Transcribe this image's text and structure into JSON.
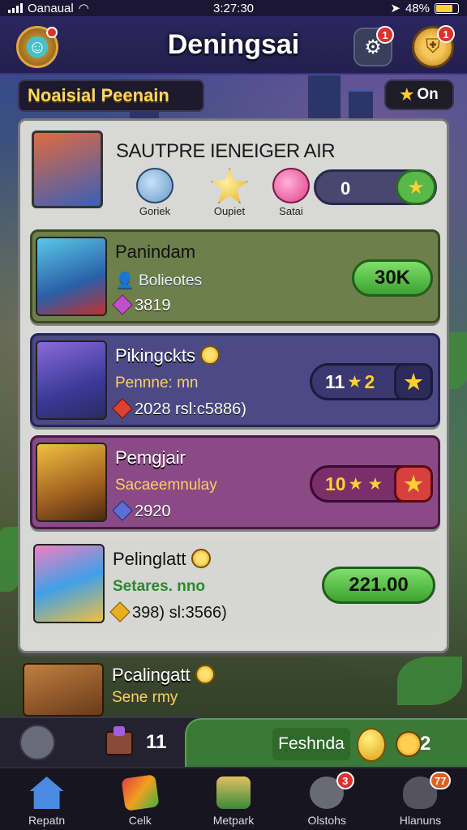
{
  "status_bar": {
    "carrier": "Oanaual",
    "time": "3:27:30",
    "battery": "48%"
  },
  "header": {
    "title": "Deningsai",
    "avatar_badge": "",
    "gear_badge": "1",
    "shield_badge": "1"
  },
  "section": {
    "label": "Noaisial Peenain",
    "toggle_label": "On"
  },
  "featured": {
    "title": "SAUTPRE IENEIGER AIR",
    "pets": [
      {
        "label": "Goriek",
        "icon": "ghost-pet-icon"
      },
      {
        "label": "Oupiet",
        "icon": "star-pet-icon"
      },
      {
        "label": "Satai",
        "icon": "pink-pet-icon"
      }
    ],
    "count": "0"
  },
  "players": [
    {
      "name": "Panindam",
      "subtitle": "Bolieotes",
      "stat": "3819",
      "score": "30K",
      "score_style": "green",
      "has_coin": false
    },
    {
      "name": "Pikingckts",
      "subtitle": "Pennne: mn",
      "stat": "2028 rsl:c5886)",
      "score": "11 ★ 2",
      "score_value": "11",
      "score_extra": "2",
      "score_style": "pill",
      "has_coin": true
    },
    {
      "name": "Pemgjair",
      "subtitle": "Sacaeemnulay",
      "stat": "2920",
      "score": "10 ★",
      "score_value": "10",
      "score_extra": "",
      "score_style": "pill",
      "has_coin": false
    },
    {
      "name": "Pelinglatt",
      "subtitle": "Setares. nno",
      "stat": "398) sl:3566)",
      "score": "221.00",
      "score_style": "green",
      "has_coin": true
    }
  ],
  "preview": {
    "name": "Pcalingatt",
    "subtitle": "Sene rmy"
  },
  "resources": {
    "chest_count": "11",
    "label": "Feshnda",
    "gem_count": "2"
  },
  "tabs": [
    {
      "label": "Repatn",
      "badge": ""
    },
    {
      "label": "Celk",
      "badge": ""
    },
    {
      "label": "Metpark",
      "badge": ""
    },
    {
      "label": "Olstohs",
      "badge": "3"
    },
    {
      "label": "Hlanuns",
      "badge": "77"
    }
  ],
  "colors": {
    "accent_gold": "#ffd85a",
    "green_button": "#58b84a",
    "badge_red": "#e0302c"
  }
}
